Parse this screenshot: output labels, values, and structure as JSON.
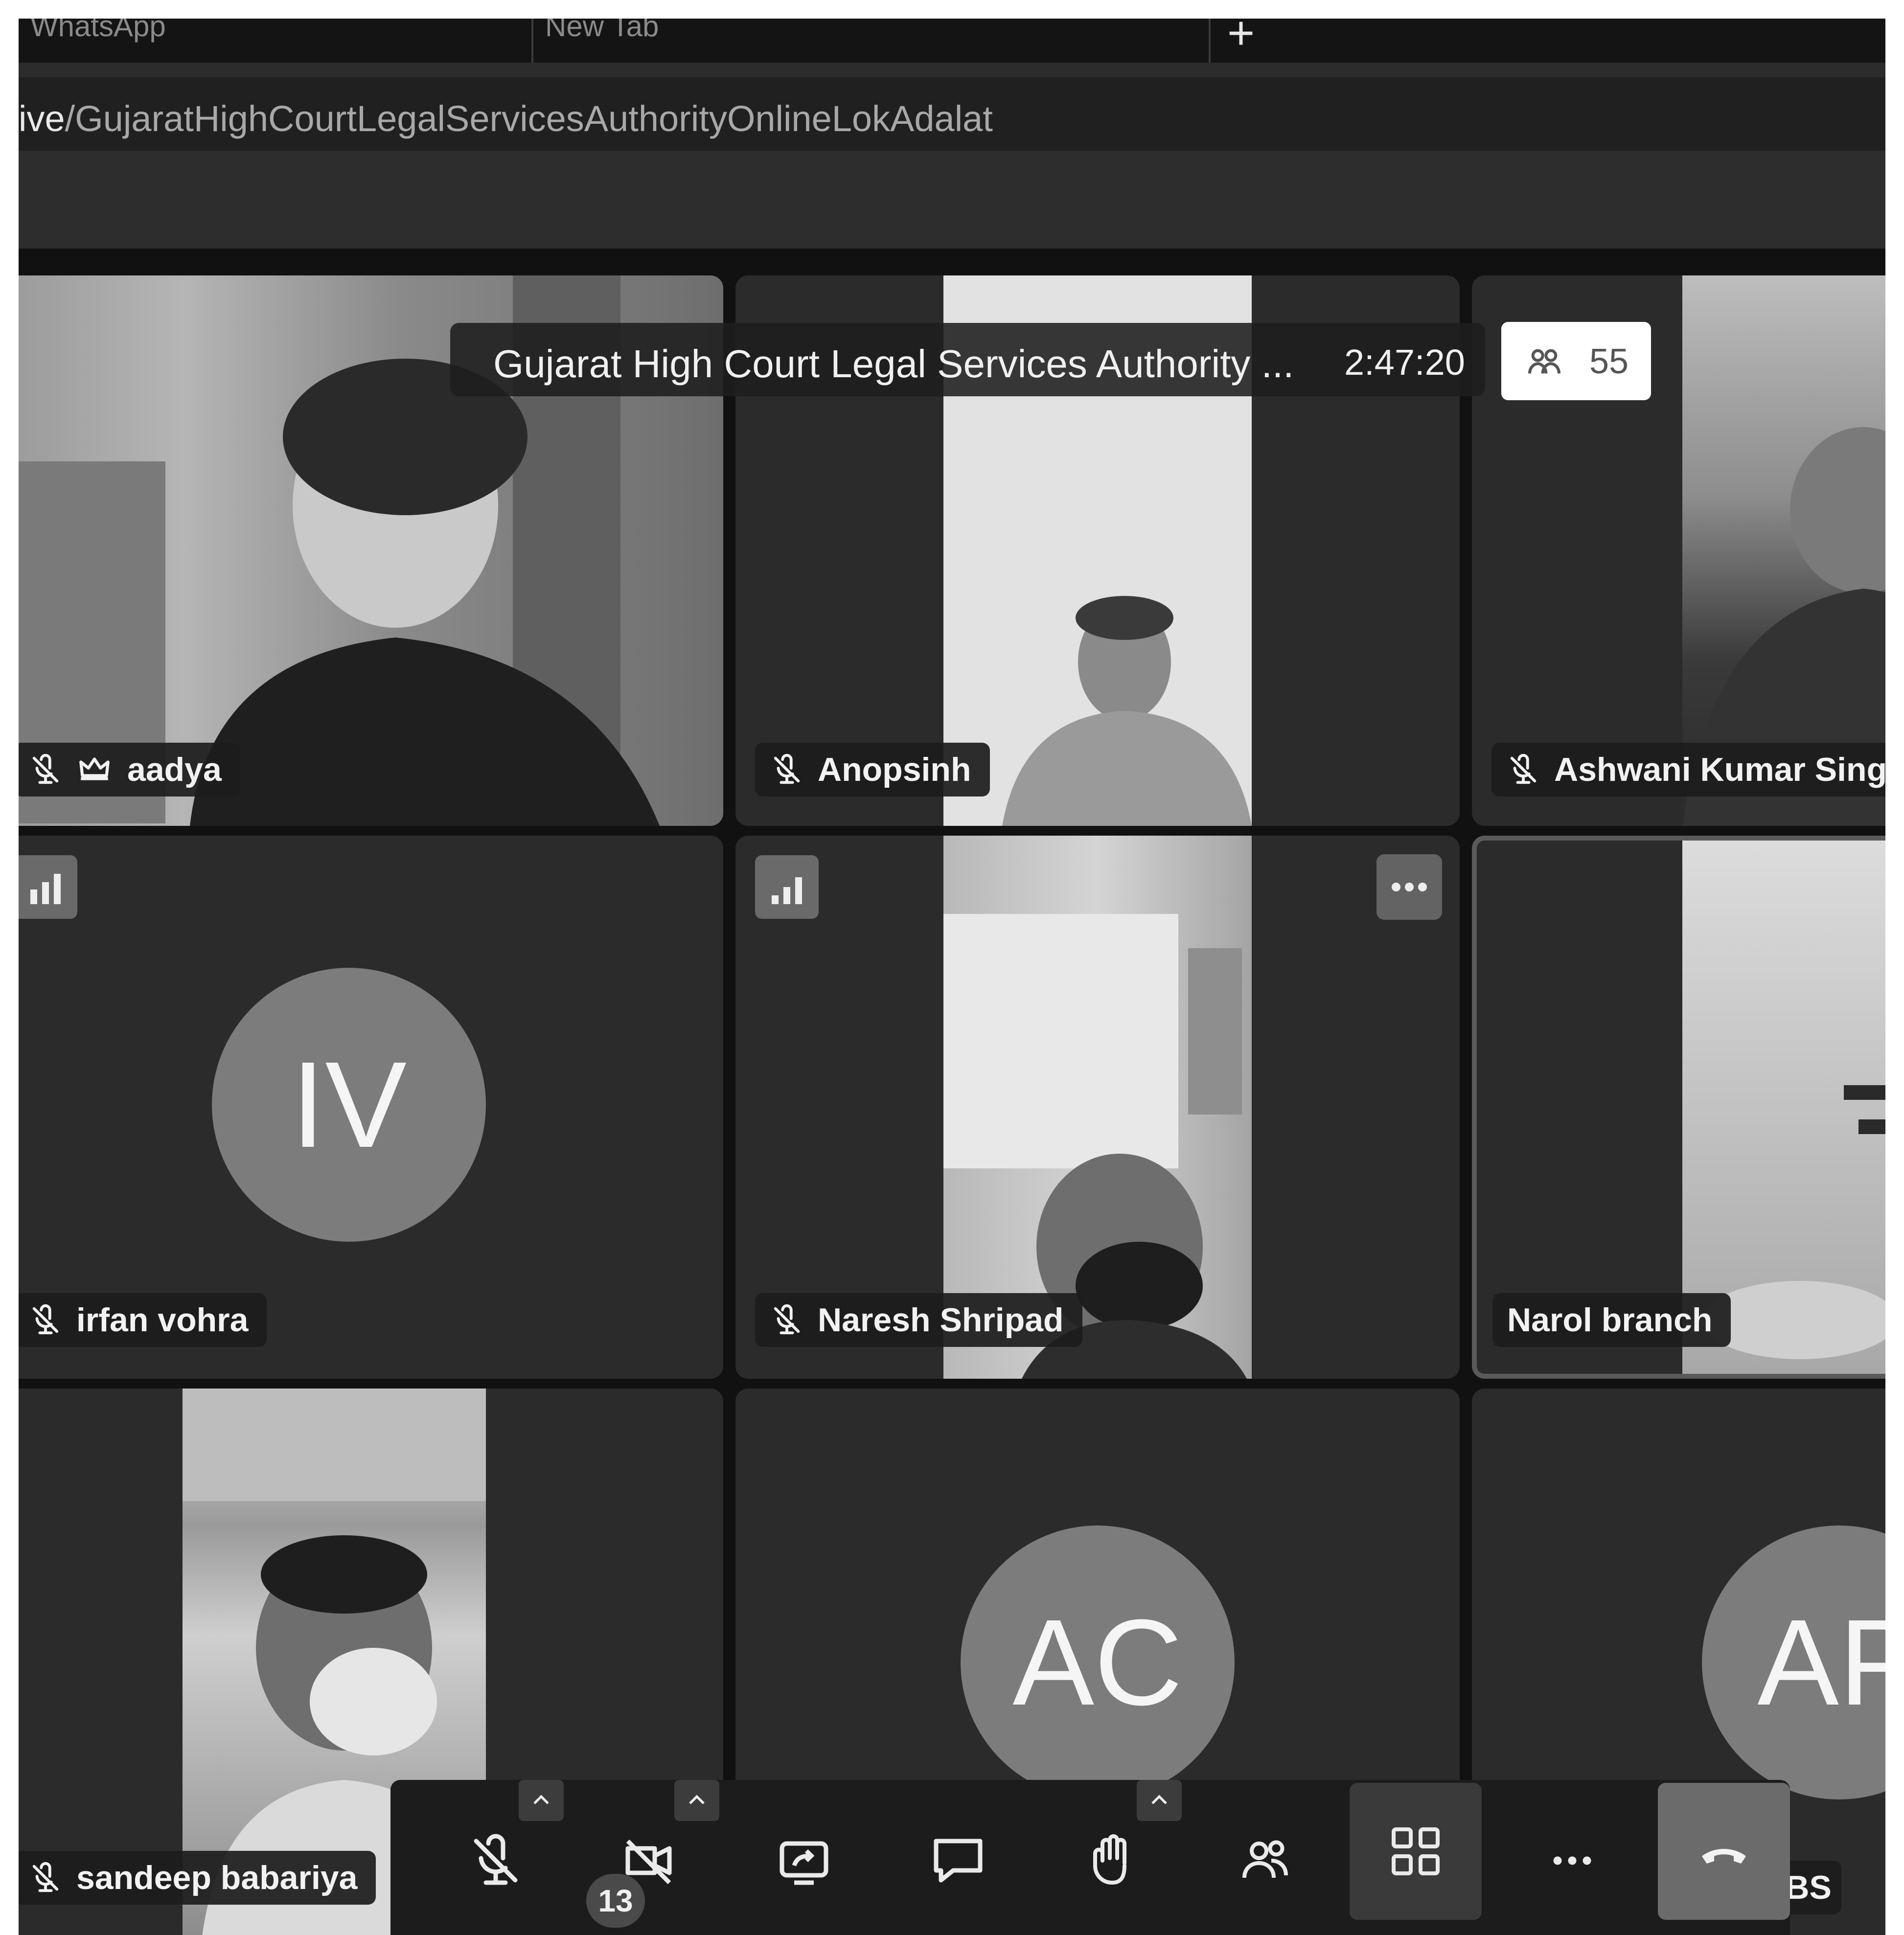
{
  "browser": {
    "tabs": [
      "WhatsApp",
      "New Tab"
    ],
    "address_prefix": "ive",
    "address_rest": "/GujaratHighCourtLegalServicesAuthorityOnlineLokAdalat"
  },
  "meeting": {
    "title": "Gujarat High Court Legal Services Authority ...",
    "elapsed": "2:47:20",
    "participant_count": "55"
  },
  "tiles": {
    "aadya": "aadya",
    "anopsinh": "Anopsinh",
    "ashwani": "Ashwani Kumar Sing",
    "irfan": "irfan vohra",
    "irfan_initials": "IV",
    "naresh": "Naresh Shripad",
    "narol": "Narol branch",
    "sandeep": "sandeep babariya",
    "ac_initials": "AC",
    "ap_initials": "AP",
    "last_partial": "ti BS"
  },
  "toolbar": {
    "chat_badge": "13"
  },
  "icons": [
    "mic-off-icon",
    "crown-icon",
    "signal-icon",
    "more-icon",
    "camera-off-icon",
    "share-screen-icon",
    "chat-icon",
    "raise-hand-icon",
    "participants-icon",
    "grid-view-icon",
    "hang-up-icon",
    "caret-up-icon",
    "plus-icon"
  ]
}
